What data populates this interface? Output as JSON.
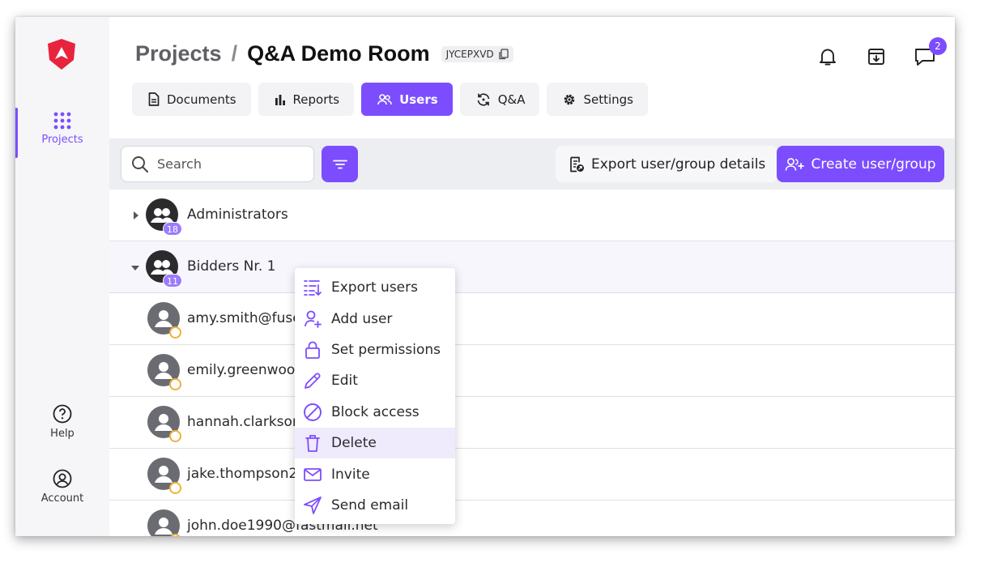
{
  "colors": {
    "accent": "#7c4dff",
    "brand_red": "#e8233d",
    "status_pending": "#f0b03a"
  },
  "rail": {
    "projects_label": "Projects",
    "help_label": "Help",
    "account_label": "Account"
  },
  "header": {
    "breadcrumb_root": "Projects",
    "breadcrumb_sep": "/",
    "title": "Q&A Demo Room",
    "room_code": "JYCEPXVD",
    "messages_badge": "2"
  },
  "tabs": [
    {
      "label": "Documents",
      "icon": "document-icon"
    },
    {
      "label": "Reports",
      "icon": "bar-chart-icon"
    },
    {
      "label": "Users",
      "icon": "users-icon",
      "active": true
    },
    {
      "label": "Q&A",
      "icon": "qa-cycle-icon"
    },
    {
      "label": "Settings",
      "icon": "gear-icon"
    }
  ],
  "toolbar": {
    "search_placeholder": "Search",
    "export_label": "Export user/group details",
    "create_label": "Create user/group"
  },
  "list": {
    "groups": [
      {
        "name": "Administrators",
        "count": "18",
        "expanded": false
      },
      {
        "name": "Bidders Nr. 1",
        "count": "11",
        "expanded": true
      }
    ],
    "users": [
      "amy.smith@fuse",
      "emily.greenwood",
      "hannah.clarksone",
      "jake.thompson20",
      "john.doe1990@fastmail.net"
    ]
  },
  "context_menu": {
    "items": [
      {
        "label": "Export users",
        "icon": "export-list-icon"
      },
      {
        "label": "Add user",
        "icon": "add-user-icon"
      },
      {
        "label": "Set permissions",
        "icon": "lock-icon"
      },
      {
        "label": "Edit",
        "icon": "pencil-icon"
      },
      {
        "label": "Block access",
        "icon": "block-icon"
      },
      {
        "label": "Delete",
        "icon": "trash-icon",
        "hovered": true
      },
      {
        "label": "Invite",
        "icon": "mail-icon"
      },
      {
        "label": "Send email",
        "icon": "send-icon"
      }
    ]
  }
}
